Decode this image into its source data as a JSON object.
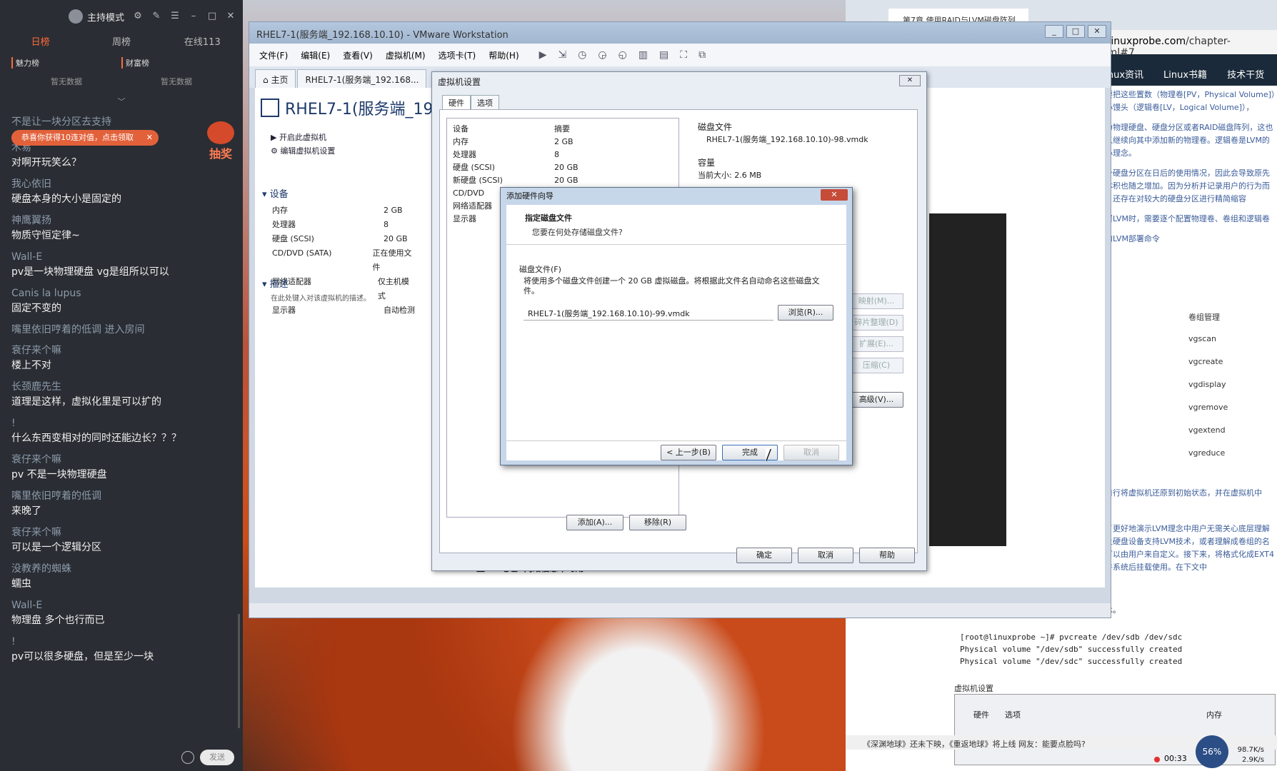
{
  "chat": {
    "mode": "主持模式",
    "tabs": [
      "日榜",
      "周榜",
      "在线113"
    ],
    "sublists": [
      {
        "label": "魅力榜",
        "empty": "暂无数据"
      },
      {
        "label": "财富榜",
        "empty": "暂无数据"
      }
    ],
    "overlap_text": "不是让一块分区去支持",
    "toast": "恭喜你获得10连对值，点击领取",
    "lottery_label": "抽奖",
    "messages": [
      {
        "name": "木易",
        "text": "对啊开玩笑么？"
      },
      {
        "name": "我心依旧",
        "text": "硬盘本身的大小是固定的"
      },
      {
        "name": "神鹰翼扬",
        "text": "物质守恒定律~"
      },
      {
        "name": "Wall-E",
        "text": "pv是一块物理硬盘 vg是组所以可以"
      },
      {
        "name": "Canis la lupus",
        "text": "固定不变的"
      },
      {
        "name": "嘴里依旧哼着的低调 进入房间",
        "text": ""
      },
      {
        "name": "衰仔来个嘛",
        "text": "楼上不对"
      },
      {
        "name": "长颈鹿先生",
        "text": "道理是这样，虚拟化里是可以扩的"
      },
      {
        "name": "!",
        "text": "什么东西变相对的同时还能边长？？？"
      },
      {
        "name": "衰仔来个嘛",
        "text": "pv 不是一块物理硬盘"
      },
      {
        "name": "嘴里依旧哼着的低调",
        "text": "来晚了"
      },
      {
        "name": "衰仔来个嘛",
        "text": "可以是一个逻辑分区"
      },
      {
        "name": "没教养的蜘蛛",
        "text": "蠕虫"
      },
      {
        "name": "Wall-E",
        "text": "物理盘 多个也行而已"
      },
      {
        "name": "!",
        "text": "pv可以很多硬盘，但是至少一块"
      }
    ],
    "send_label": "发送"
  },
  "browser": {
    "tab_title": "第7章 使用RAID与LVM磁盘阵列",
    "url_host": "www.linuxprobe.com",
    "url_path": "/chapter-07.html#7",
    "nav": [
      "Linux资讯",
      "Linux书籍",
      "技术干货"
    ],
    "paragraphs": [
      "需要把这些置数（物理卷[PV，Physical Volume]）个小馒头（逻辑卷[LV，Logical Volume]），",
      "以为物理硬盘、硬盘分区或者RAID磁盘阵列，这也可以继续向其中添加新的物理卷。逻辑卷是LVM的核心理念。",
      "每个硬盘分区在日后的使用情况，因此会导致原先的体积也随之增加。因为分析并记录用户的行为而且，还存在对较大的硬盘分区进行精简缩容",
      "部署LVM时，需要逐个配置物理卷、卷组和逻辑卷",
      "用的LVM部署命令"
    ],
    "cmd_header": "卷组管理",
    "cmds": [
      "vgscan",
      "vgcreate",
      "vgdisplay",
      "vgremove",
      "vgextend",
      "vgreduce"
    ],
    "para2": "要自行将虚拟机还原到初始状态，并在虚拟机中",
    "para3": "为了更好地演示LVM理念中用户无需关心底层理解成让硬盘设备支持LVM技术，或者理解成卷组的名称可以由用户来自定义。接下来，将格式化成EXT4文件系统后挂载使用。在下文中",
    "para4": "技术。",
    "code": [
      "[root@linuxprobe ~]# pvcreate /dev/sdb /dev/sdc",
      " Physical volume \"/dev/sdb\" successfully created",
      " Physical volume \"/dev/sdc\" successfully created"
    ],
    "caption": "虚拟机设置",
    "bottom_tabs": [
      "硬件",
      "选项"
    ],
    "bottom_right": "内存",
    "status": "《深渊地球》还未下映，《重返地球》将上线 网友：能要点脸吗?",
    "gauge": "56%",
    "timer": "00:33",
    "net_up": "98.7K/s",
    "net_down": "2.9K/s"
  },
  "vmware": {
    "window_title": "RHEL7-1(服务端_192.168.10.10) - VMware Workstation",
    "menus": [
      "文件(F)",
      "编辑(E)",
      "查看(V)",
      "虚拟机(M)",
      "选项卡(T)",
      "帮助(H)"
    ],
    "tabs": [
      "主页",
      "RHEL7-1(服务端_192.168..."
    ],
    "vm_title": "RHEL7-1(服务端_192.10",
    "actions": [
      "开启此虚拟机",
      "编辑虚拟机设置"
    ],
    "devices_heading": "设备",
    "devices": [
      {
        "name": "内存",
        "value": "2 GB"
      },
      {
        "name": "处理器",
        "value": "8"
      },
      {
        "name": "硬盘 (SCSI)",
        "value": "20 GB"
      },
      {
        "name": "CD/DVD (SATA)",
        "value": "正在使用文件"
      },
      {
        "name": "网络适配器",
        "value": "仅主机模式"
      },
      {
        "name": "显示器",
        "value": "自动检测"
      }
    ],
    "desc_heading": "描述",
    "desc_text": "在此处键入对该虚拟机的描述。",
    "ip_line": "主 IP 地址: 网络信息不可用"
  },
  "vmsettings": {
    "title": "虚拟机设置",
    "tabs": [
      "硬件",
      "选项"
    ],
    "col_device": "设备",
    "col_summary": "摘要",
    "rows": [
      {
        "name": "内存",
        "value": "2 GB"
      },
      {
        "name": "处理器",
        "value": "8"
      },
      {
        "name": "硬盘 (SCSI)",
        "value": "20 GB"
      },
      {
        "name": "新硬盘 (SCSI)",
        "value": "20 GB"
      },
      {
        "name": "CD/DVD",
        "value": ""
      },
      {
        "name": "网络适配器",
        "value": ""
      },
      {
        "name": "显示器",
        "value": ""
      }
    ],
    "disk_file_label": "磁盘文件",
    "disk_file_value": "RHEL7-1(服务端_192.168.10.10)-98.vmdk",
    "capacity_label": "容量",
    "current_size": "当前大小: 2.6 MB",
    "ghost_buttons": [
      "映射(M)...",
      "碎片整理(D)",
      "扩展(E)...",
      "压缩(C)"
    ],
    "advanced": "高级(V)...",
    "add": "添加(A)...",
    "remove": "移除(R)",
    "ok": "确定",
    "cancel": "取消",
    "help": "帮助"
  },
  "wizard": {
    "title": "添加硬件向导",
    "heading": "指定磁盘文件",
    "subheading": "您要在何处存储磁盘文件?",
    "field_label": "磁盘文件(F)",
    "note": "将使用多个磁盘文件创建一个 20 GB 虚拟磁盘。将根据此文件名自动命名这些磁盘文件。",
    "file_value": "RHEL7-1(服务端_192.168.10.10)-99.vmdk",
    "browse": "浏览(R)...",
    "back": "< 上一步(B)",
    "finish": "完成",
    "cancel": "取消"
  }
}
